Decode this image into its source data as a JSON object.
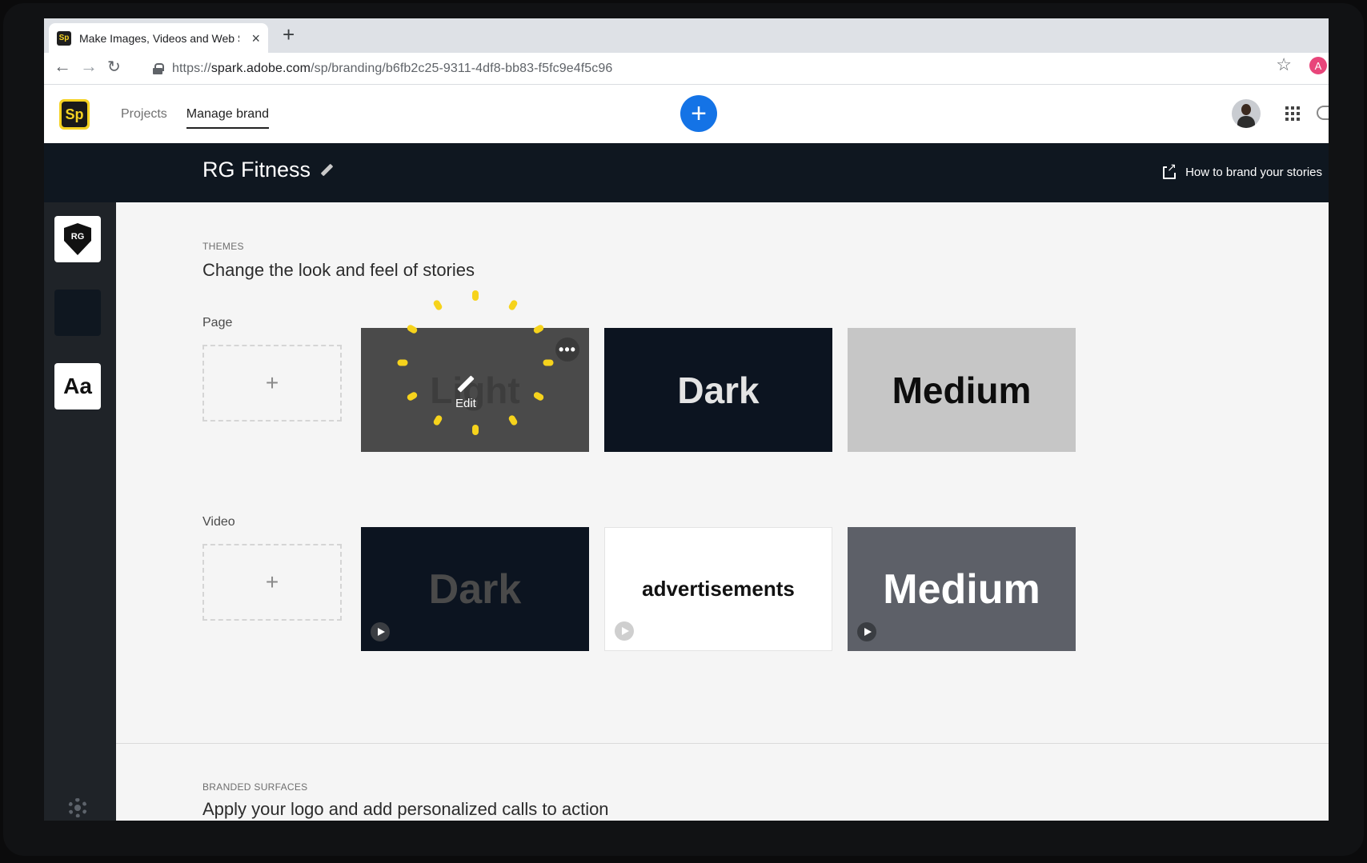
{
  "browser": {
    "tab_title": "Make Images, Videos and Web Stories",
    "favicon": "Sp",
    "url_prefix": "https://",
    "url_host": "spark.adobe.com",
    "url_path": "/sp/branding/b6fb2c25-9311-4df8-bb83-f5fc9e4f5c96",
    "profile_initial": "A"
  },
  "app": {
    "logo": "Sp",
    "nav": [
      "Projects",
      "Manage brand"
    ],
    "create_symbol": "+"
  },
  "brand": {
    "name": "RG Fitness",
    "help_link": "How to brand your stories"
  },
  "rail": {
    "logo_text": "RG",
    "font_sample": "Aa"
  },
  "themes": {
    "eyebrow": "THEMES",
    "title": "Change the look and feel of stories",
    "page_label": "Page",
    "video_label": "Video",
    "add_symbol": "+",
    "page_tiles": [
      "Light",
      "Dark",
      "Medium"
    ],
    "edit_label": "Edit",
    "more_symbol": "•••",
    "video_tiles": [
      "Dark",
      "advertisements",
      "Medium"
    ]
  },
  "branded_surfaces": {
    "eyebrow": "BRANDED SURFACES",
    "title": "Apply your logo and add personalized calls to action"
  },
  "colors": {
    "accent": "#1473e6",
    "brand_dark": "#0f1720",
    "highlight": "#f6d31c"
  }
}
